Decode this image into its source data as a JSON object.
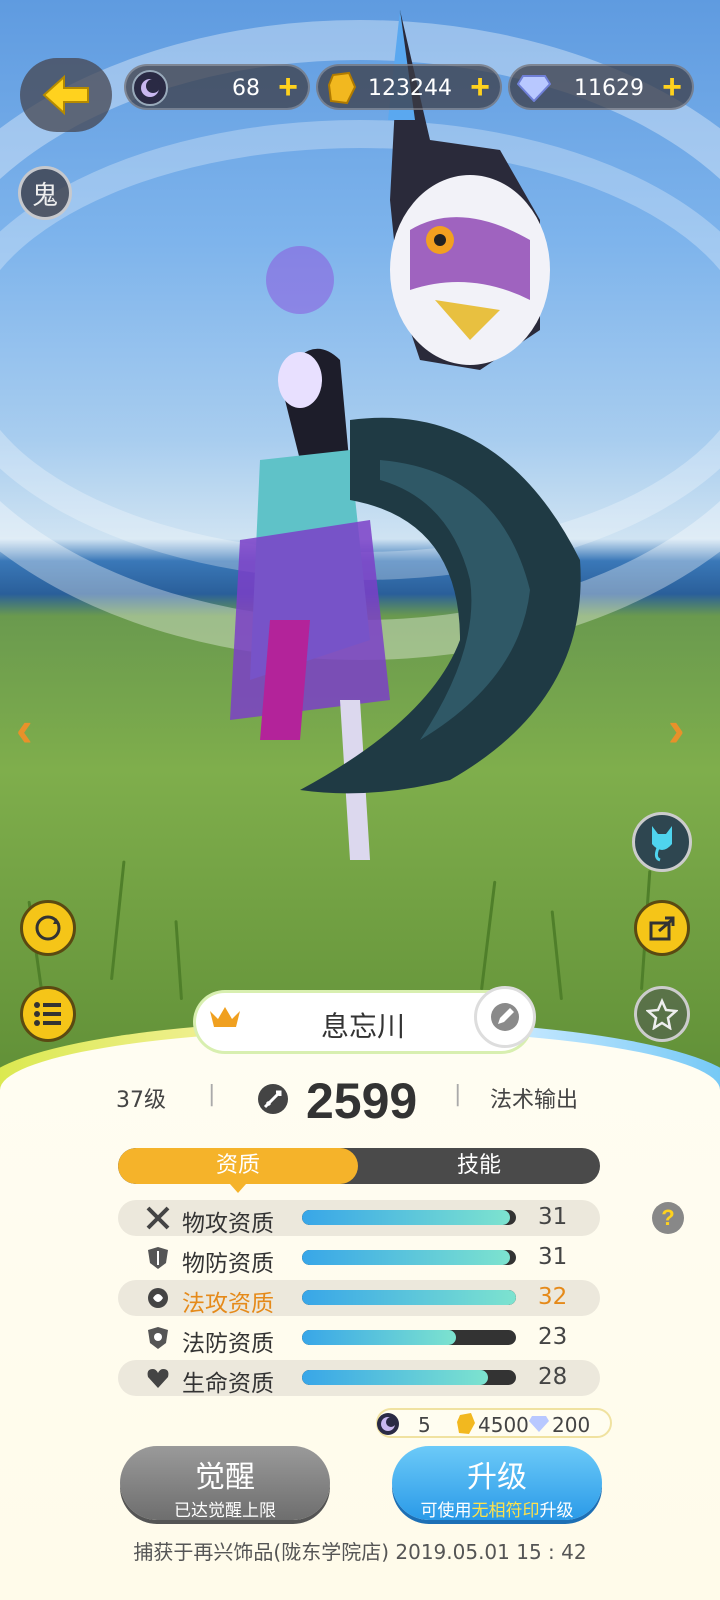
{
  "resources": [
    {
      "icon": "moon-orb-icon",
      "value": "68",
      "plus": "+"
    },
    {
      "icon": "gold-crystal-icon",
      "value": "123244",
      "plus": "+"
    },
    {
      "icon": "diamond-icon",
      "value": "11629",
      "plus": "+"
    }
  ],
  "badge": "鬼",
  "nav": {
    "prev": "‹",
    "next": "›"
  },
  "pet": {
    "name": "息忘川",
    "level": "37级",
    "power": "2599",
    "role": "法术输出",
    "separator": "|"
  },
  "tabs": {
    "active": "资质",
    "other": "技能"
  },
  "stats": [
    {
      "label": "物攻资质",
      "value": "31",
      "fill": 0.97,
      "icon": "crossed-swords-icon",
      "highlight": false
    },
    {
      "label": "物防资质",
      "value": "31",
      "fill": 0.97,
      "icon": "shield-icon",
      "highlight": false
    },
    {
      "label": "法攻资质",
      "value": "32",
      "fill": 1.0,
      "icon": "magic-swirl-icon",
      "highlight": true
    },
    {
      "label": "法防资质",
      "value": "23",
      "fill": 0.72,
      "icon": "magic-shield-icon",
      "highlight": false
    },
    {
      "label": "生命资质",
      "value": "28",
      "fill": 0.87,
      "icon": "heart-icon",
      "highlight": false
    }
  ],
  "help": "?",
  "cost": {
    "orb": "5",
    "crystal": "4500",
    "diamond": "200"
  },
  "buttons": {
    "awaken": {
      "main": "觉醒",
      "sub": "已达觉醒上限"
    },
    "upgrade": {
      "main": "升级",
      "sub_pre": "可使用",
      "sub_hl": "无相符印",
      "sub_post": "升级"
    }
  },
  "footer": "捕获于再兴饰品(陇东学院店) 2019.05.01   15 : 42",
  "colors": {
    "accent": "#f5b32a",
    "highlight": "#e58a1a",
    "bar": "#38a6e8",
    "upgrade": "#2a9ae8"
  }
}
